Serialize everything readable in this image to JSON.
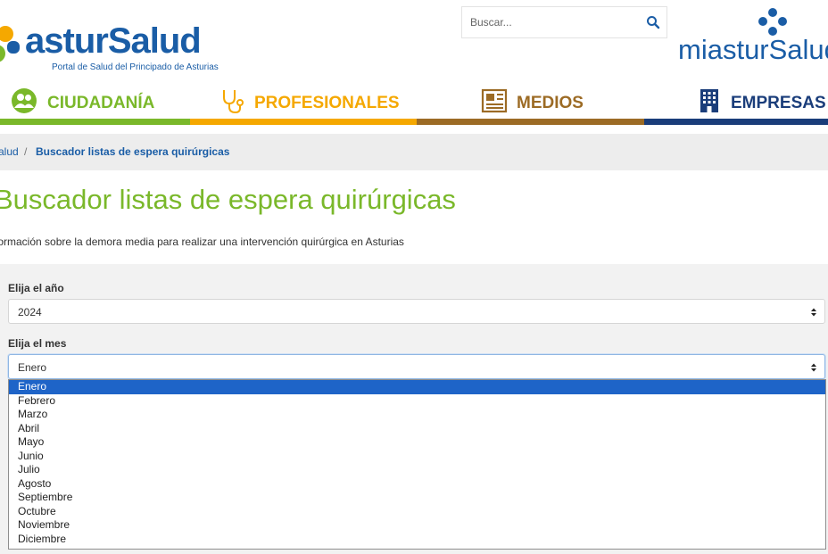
{
  "header": {
    "logo_text": "asturSalud",
    "logo_subtitle": "Portal de Salud del Principado de Asturias",
    "search": {
      "placeholder": "Buscar..."
    },
    "mias_logo_text": "miasturSalud"
  },
  "nav": [
    {
      "label": "CIUDADANÍA",
      "icon": "people-icon",
      "color": "#7ab82a"
    },
    {
      "label": "PROFESIONALES",
      "icon": "stethoscope-icon",
      "color": "#f5a800"
    },
    {
      "label": "MEDIOS",
      "icon": "newspaper-icon",
      "color": "#9c6b25"
    },
    {
      "label": "EMPRESAS",
      "icon": "building-icon",
      "color": "#1a3d7a"
    }
  ],
  "breadcrumb": {
    "home": "alud",
    "separator": "/",
    "current": "Buscador listas de espera quirúrgicas"
  },
  "page": {
    "title": "Buscador listas de espera quirúrgicas",
    "intro": "formación sobre la demora media para realizar una intervención quirúrgica en Asturias"
  },
  "form": {
    "year_label": "Elija el año",
    "year_value": "2024",
    "month_label": "Elija el mes",
    "month_value": "Enero",
    "month_options": [
      "Enero",
      "Febrero",
      "Marzo",
      "Abril",
      "Mayo",
      "Junio",
      "Julio",
      "Agosto",
      "Septiembre",
      "Octubre",
      "Noviembre",
      "Diciembre"
    ],
    "selected_index": 0
  },
  "colors": {
    "brand_blue": "#1a5da6",
    "brand_green": "#7ab82a",
    "highlight": "#1e64c8"
  }
}
